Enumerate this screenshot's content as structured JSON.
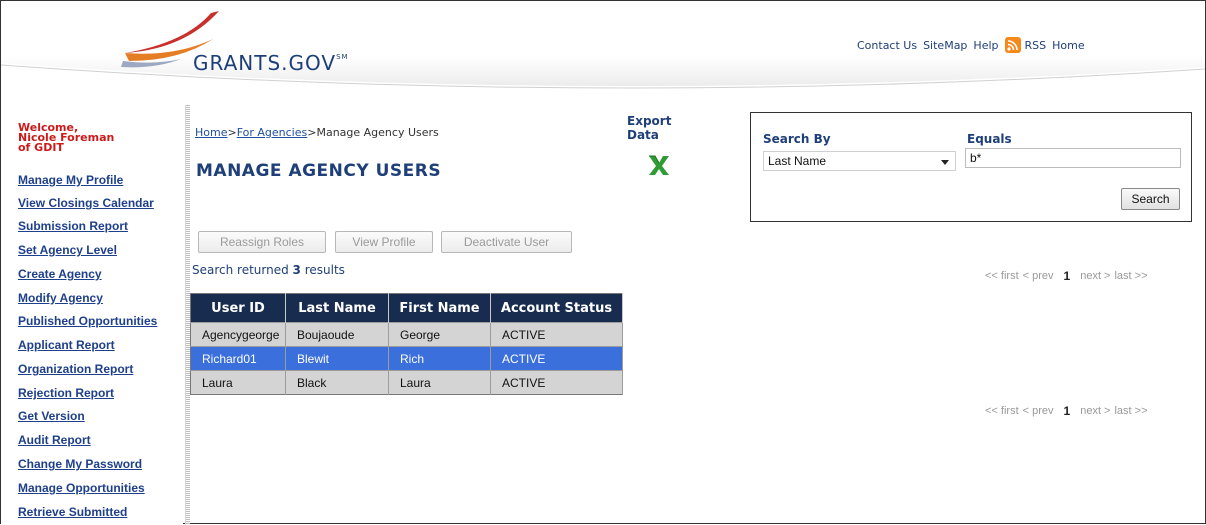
{
  "header": {
    "logo_text": "GRANTS.GOV",
    "logo_sup": "SM",
    "links": [
      "Contact Us",
      "SiteMap",
      "Help",
      "RSS",
      "Home"
    ]
  },
  "sidebar": {
    "welcome_line1": "Welcome,",
    "welcome_line2": "Nicole Foreman",
    "welcome_line3": "of GDIT",
    "items": [
      "Manage My Profile",
      "View Closings Calendar",
      "Submission Report",
      "Set Agency Level",
      "Create Agency",
      "Modify Agency",
      "Published Opportunities",
      "Applicant Report",
      "Organization Report",
      "Rejection Report",
      "Get Version",
      "Audit Report",
      "Change My Password",
      "Manage Opportunities",
      "Retrieve Submitted"
    ]
  },
  "breadcrumb": {
    "home": "Home",
    "sep1": ">",
    "agencies": "For Agencies",
    "sep2": ">",
    "current": "Manage Agency Users"
  },
  "page_title": "MANAGE AGENCY USERS",
  "export": {
    "line1": "Export",
    "line2": "Data",
    "icon": "excel-export-icon"
  },
  "actions": {
    "reassign": "Reassign Roles",
    "view_profile": "View Profile",
    "deactivate": "Deactivate User"
  },
  "results": {
    "prefix": "Search returned ",
    "count": "3",
    "suffix": " results"
  },
  "pager": {
    "first": "<< first",
    "prev": "< prev",
    "current": "1",
    "next": "next >",
    "last": "last >>"
  },
  "table": {
    "headers": [
      "User ID",
      "Last Name",
      "First Name",
      "Account Status"
    ],
    "rows": [
      [
        "Agencygeorge",
        "Boujaoude",
        "George",
        "ACTIVE"
      ],
      [
        "Richard01",
        "Blewit",
        "Rich",
        "ACTIVE"
      ],
      [
        "Laura",
        "Black",
        "Laura",
        "ACTIVE"
      ]
    ]
  },
  "search": {
    "by_label": "Search By",
    "by_value": "Last Name",
    "equals_label": "Equals",
    "equals_value": "b*",
    "button": "Search"
  },
  "colors": {
    "nav_link": "#1e3f8a",
    "welcome": "#cc1a1a",
    "table_header": "#172c4f",
    "selected_row": "#3b6fdb"
  }
}
